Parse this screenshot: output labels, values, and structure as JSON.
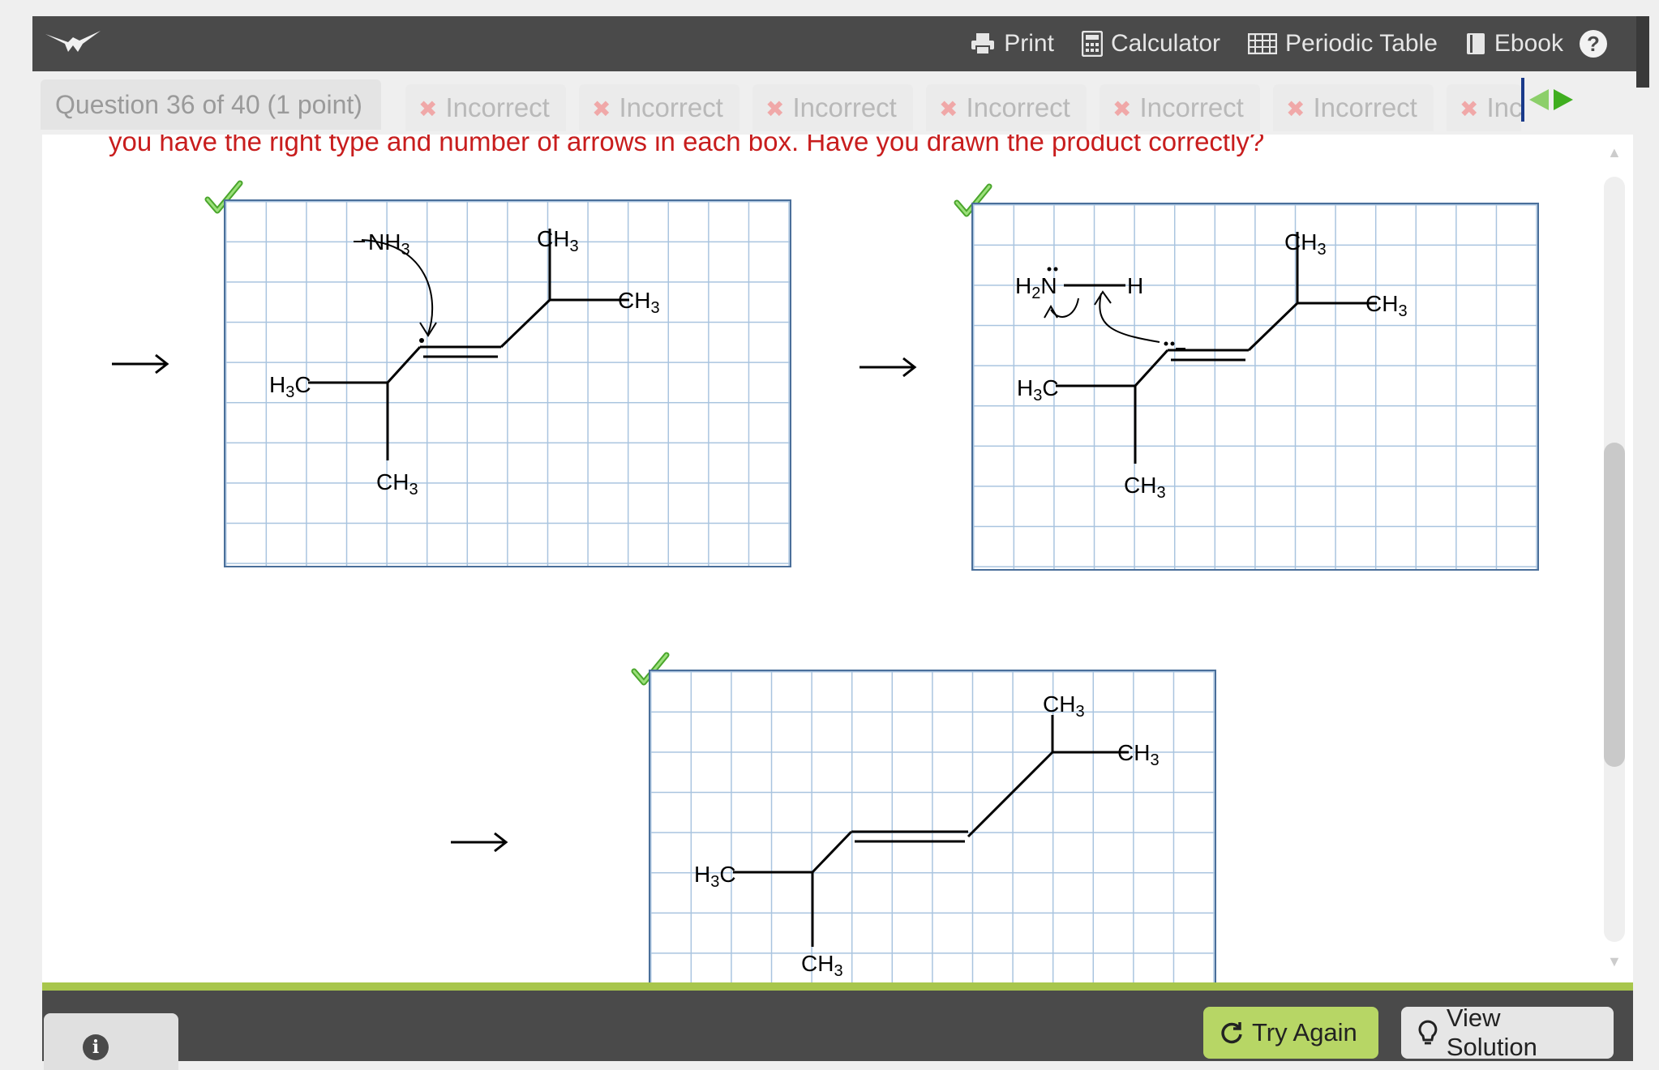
{
  "toolbar": {
    "logo": "sapling-bird-logo",
    "tools": [
      {
        "icon": "printer-icon",
        "label": "Print"
      },
      {
        "icon": "calculator-icon",
        "label": "Calculator"
      },
      {
        "icon": "periodic-table-icon",
        "label": "Periodic Table"
      },
      {
        "icon": "book-icon",
        "label": "Ebook"
      }
    ],
    "help": "?"
  },
  "tabs": {
    "question": "Question 36 of 40 (1 point)",
    "attempts": [
      {
        "mark": "✖",
        "label": "Incorrect"
      },
      {
        "mark": "✖",
        "label": "Incorrect"
      },
      {
        "mark": "✖",
        "label": "Incorrect"
      },
      {
        "mark": "✖",
        "label": "Incorrect"
      },
      {
        "mark": "✖",
        "label": "Incorrect"
      },
      {
        "mark": "✖",
        "label": "Incorrect"
      },
      {
        "mark": "✖",
        "label": "Incorrect"
      }
    ]
  },
  "feedback": "you have the right type and number of arrows in each box. Have you drawn the product correctly?",
  "panels": {
    "step1": {
      "labels": {
        "nh3": "NH",
        "nh3_sub": "3",
        "ch3_top": "CH",
        "ch3_top_sub": "3",
        "ch3_right": "CH",
        "ch3_right_sub": "3",
        "h3c": "H",
        "h3c_sub": "3",
        "h3c_c": "C",
        "ch3_bottom": "CH",
        "ch3_bottom_sub": "3"
      },
      "status": "correct"
    },
    "step2": {
      "labels": {
        "h2n": "H",
        "h2n_sub": "2",
        "h2n_n": "N",
        "h": "H",
        "ch3_top": "CH",
        "ch3_top_sub": "3",
        "ch3_right": "CH",
        "ch3_right_sub": "3",
        "h3c": "H",
        "h3c_sub": "3",
        "h3c_c": "C",
        "ch3_bottom": "CH",
        "ch3_bottom_sub": "3"
      },
      "status": "correct"
    },
    "step3": {
      "labels": {
        "ch3_top": "CH",
        "ch3_top_sub": "3",
        "ch3_right": "CH",
        "ch3_right_sub": "3",
        "h3c": "H",
        "h3c_sub": "3",
        "h3c_c": "C",
        "ch3_bottom": "CH",
        "ch3_bottom_sub": "3"
      },
      "status": "correct"
    }
  },
  "footer": {
    "info": "i",
    "try_again": "Try Again",
    "view_solution": "View Solution"
  },
  "colors": {
    "toolbar": "#4a4a4a",
    "feedback": "#c81d1d",
    "check": "#5cb832",
    "try_again": "#b7d665",
    "footer_accent": "#a8c64c"
  }
}
